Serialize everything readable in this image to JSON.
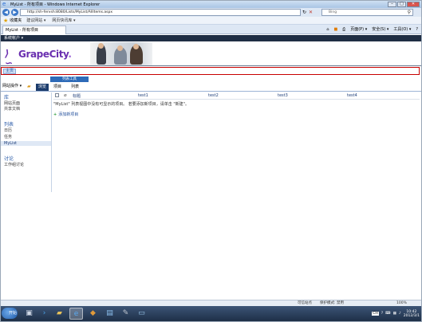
{
  "browser": {
    "title": "MyList - 所有项目 - Windows Internet Explorer",
    "address": "http://sh-fervsh:8080/Lists/MyList/AllItems.aspx",
    "search_placeholder": "Bing",
    "favorites_label": "收藏夹",
    "favorites_items": [
      "建议网站 ▾",
      "网页快讯库 ▾"
    ],
    "tab_label": "MyList - 所有项目",
    "commands": [
      "页面(P) ▾",
      "安全(S) ▾",
      "工具(O) ▾"
    ],
    "status": {
      "zone": "可信站点",
      "protected_mode": "保护模式: 禁用",
      "zoom": "100%"
    }
  },
  "sharepoint": {
    "top_bar_user": "系统帐户 ▾",
    "logo": {
      "mark": "⟩∽",
      "text": "GrapeCity",
      "dot": "."
    },
    "breadcrumb_home": "主页",
    "ribbon": {
      "site_actions": "网站操作 ▾",
      "browse": "浏览",
      "list_tools": "列表工具",
      "tabs": [
        "项目",
        "列表"
      ]
    },
    "quick_launch": {
      "sections": [
        {
          "heading": "库",
          "items": [
            "网站页面",
            "共享文档"
          ]
        },
        {
          "heading": "列表",
          "items": [
            "日历",
            "任务",
            "MyList"
          ]
        },
        {
          "heading": "讨论",
          "items": [
            "工作组讨论"
          ]
        }
      ],
      "selected": "MyList"
    },
    "list": {
      "columns": [
        "标题",
        "test1",
        "test2",
        "test3",
        "test4"
      ],
      "empty_message": "\"MyList\" 列表视图中没有可显示的项目。 若要添加新项目，请单击 \"新建\"。",
      "add_item": "添加新项目"
    }
  },
  "taskbar": {
    "start_label": "开始",
    "language": "CH",
    "time": "10:42",
    "date": "2012/3/1"
  },
  "colors": {
    "brand_purple": "#6a2fb0",
    "sp_dark": "#1f2e44",
    "link_blue": "#1f4d9a",
    "highlight_red": "#c80000"
  }
}
